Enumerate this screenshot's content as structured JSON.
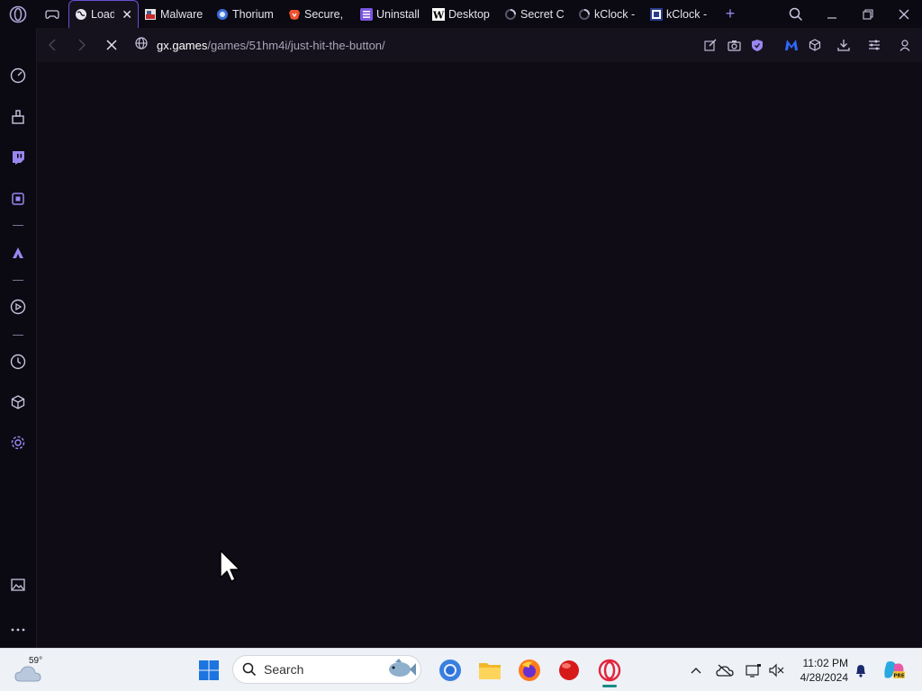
{
  "browser": {
    "tabs": [
      {
        "label": "Load",
        "icon": "globe-icon",
        "active": true
      },
      {
        "label": "Malware",
        "icon": "malware-site-icon"
      },
      {
        "label": "Thorium",
        "icon": "thorium-icon"
      },
      {
        "label": "Secure, ",
        "icon": "brave-icon"
      },
      {
        "label": "Uninstall",
        "icon": "list-icon"
      },
      {
        "label": "Desktop",
        "icon": "w-icon"
      },
      {
        "label": "Secret C",
        "icon": "loading-icon"
      },
      {
        "label": "kClock -",
        "icon": "loading-icon"
      },
      {
        "label": "kClock -",
        "icon": "kclock-icon"
      }
    ],
    "url": {
      "host": "gx.games",
      "path": "/games/51hm4i/just-hit-the-button/"
    },
    "accent": "#9a86f0"
  },
  "taskbar": {
    "weather_temp": "59°",
    "search_label": "Search",
    "time": "11:02 PM",
    "date": "4/28/2024"
  }
}
